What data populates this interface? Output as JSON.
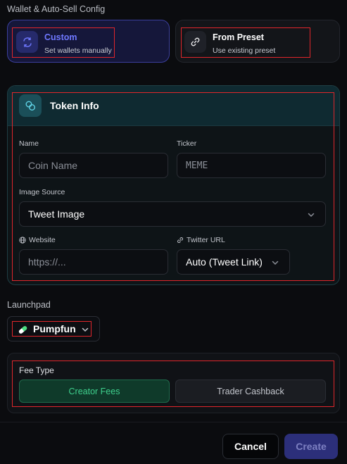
{
  "header": {
    "title": "Wallet & Auto-Sell Config"
  },
  "modes": [
    {
      "title": "Custom",
      "subtitle": "Set wallets manually",
      "icon": "shuffle-icon",
      "selected": true
    },
    {
      "title": "From Preset",
      "subtitle": "Use existing preset",
      "icon": "link-icon",
      "selected": false
    }
  ],
  "token_info": {
    "title": "Token Info",
    "icon": "coins-icon",
    "name": {
      "label": "Name",
      "placeholder": "Coin Name"
    },
    "ticker": {
      "label": "Ticker",
      "placeholder": "MEME"
    },
    "image_source": {
      "label": "Image Source",
      "value": "Tweet Image"
    },
    "website": {
      "label": "Website",
      "placeholder": "https://..."
    },
    "twitter_url": {
      "label": "Twitter URL",
      "value": "Auto (Tweet Link)"
    }
  },
  "launchpad": {
    "label": "Launchpad",
    "value": "Pumpfun",
    "icon": "pill-icon"
  },
  "fee_type": {
    "label": "Fee Type",
    "options": [
      {
        "label": "Creator Fees",
        "selected": true
      },
      {
        "label": "Trader Cashback",
        "selected": false
      }
    ]
  },
  "footer": {
    "cancel_label": "Cancel",
    "create_label": "Create"
  },
  "colors": {
    "accent": "#6f78ff",
    "teal": "#5fd3e6",
    "green": "#3fd08d",
    "highlight": "#e0262b"
  }
}
